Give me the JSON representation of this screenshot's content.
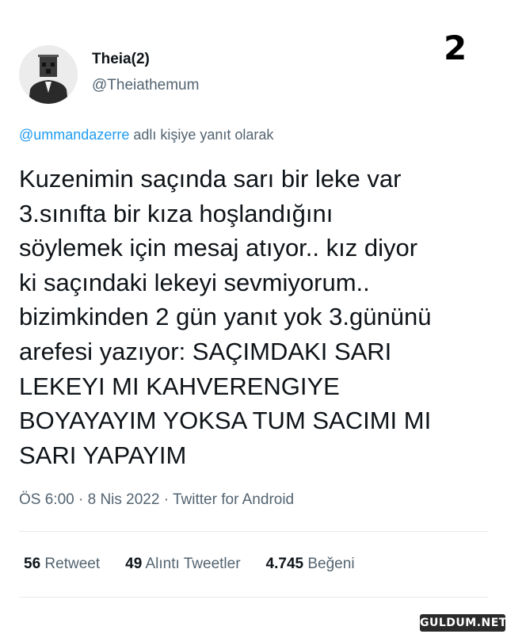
{
  "corner_number": "2",
  "author": {
    "display_name": "Theia(2)",
    "handle": "@Theiathemum",
    "avatar_icon": "masked-person-avatar"
  },
  "reply_context": {
    "mention": "@ummandazerre",
    "suffix": " adlı kişiye yanıt olarak"
  },
  "tweet": {
    "lines": [
      "Kuzenimin saçında sarı bir leke var",
      "3.sınıfta bir kıza hoşlandığını",
      "söylemek için mesaj atıyor.. kız diyor",
      "ki saçındaki lekeyi sevmiyorum..",
      "bizimkinden 2 gün yanıt yok 3.gününü",
      "arefesi yazıyor: SAÇIMDAKI SARI",
      "LEKEYI MI KAHVERENGIYE",
      "BOYAYAYIM YOKSA TUM SACIMI MI",
      "SARI YAPAYIM"
    ]
  },
  "meta": {
    "time": "ÖS 6:00",
    "sep1": " · ",
    "date": "8 Nis 2022",
    "sep2": " · ",
    "source": "Twitter for Android"
  },
  "stats": {
    "retweets_count": "56",
    "retweets_label": " Retweet",
    "quotes_count": "49",
    "quotes_label": " Alıntı Tweetler",
    "likes_count": "4.745",
    "likes_label": " Beğeni"
  },
  "watermark": "GULDUM.NET",
  "colors": {
    "accent": "#1d9bf0",
    "text": "#0f1419",
    "secondary": "#536471",
    "divider": "#e7e9ea"
  }
}
